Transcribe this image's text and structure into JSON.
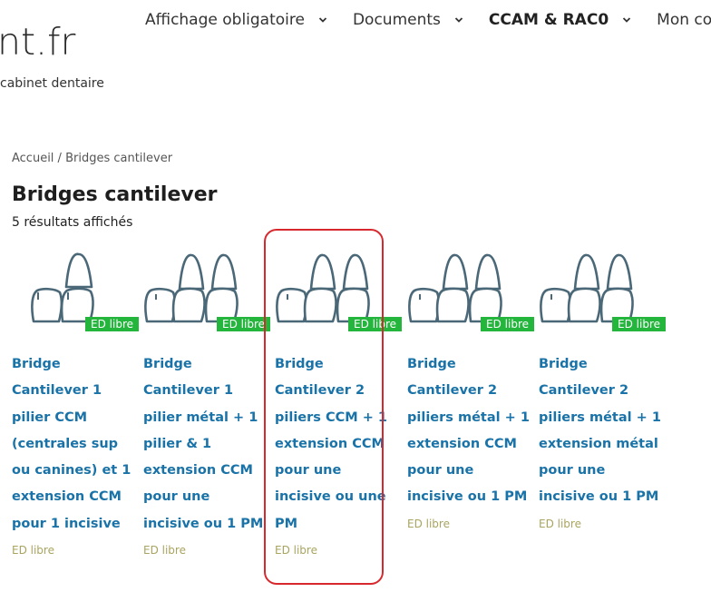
{
  "site": {
    "logo": "nt.fr",
    "tagline": "cabinet dentaire"
  },
  "nav": [
    {
      "label": "Affichage obligatoire"
    },
    {
      "label": "Documents"
    },
    {
      "label": "CCAM & RAC0"
    },
    {
      "label": "Mon com"
    }
  ],
  "breadcrumb": {
    "home": "Accueil",
    "sep": " / ",
    "current": "Bridges cantilever"
  },
  "page": {
    "title": "Bridges cantilever",
    "result_count": "5 résultats affichés"
  },
  "products": [
    {
      "badge": "ED libre",
      "name_lines": [
        "Bridge",
        "Cantilever 1",
        "pilier CCM",
        "(centrales sup",
        "ou canines) et 1",
        "extension CCM",
        "pour 1 incisive"
      ],
      "label": "ED libre",
      "teeth": 2
    },
    {
      "badge": "ED libre",
      "name_lines": [
        "Bridge",
        "Cantilever 1",
        "pilier métal + 1",
        "pilier & 1",
        "extension CCM",
        "pour une",
        "incisive ou 1 PM"
      ],
      "label": "ED libre",
      "teeth": 3
    },
    {
      "badge": "ED libre",
      "name_lines": [
        "Bridge",
        "Cantilever 2",
        "piliers CCM + 1",
        "extension CCM",
        "pour une",
        "incisive ou une",
        "PM"
      ],
      "label": "ED libre",
      "teeth": 3
    },
    {
      "badge": "ED libre",
      "name_lines": [
        "Bridge",
        "Cantilever 2",
        "piliers métal + 1",
        "extension CCM",
        "pour une",
        "incisive ou 1 PM"
      ],
      "label": "ED libre",
      "teeth": 3
    },
    {
      "badge": "ED libre",
      "name_lines": [
        "Bridge",
        "Cantilever 2",
        "piliers métal + 1",
        "extension métal",
        "pour une",
        "incisive ou 1 PM"
      ],
      "label": "ED libre",
      "teeth": 3
    }
  ],
  "colors": {
    "link": "#1a73a8",
    "badge": "#24b53c",
    "tooth_stroke": "#4a6878",
    "highlight": "#d7282e",
    "label": "#a9a560"
  }
}
